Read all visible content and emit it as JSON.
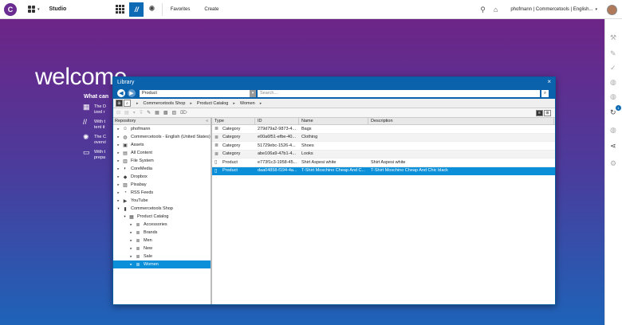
{
  "topbar": {
    "app_name": "Studio",
    "nav": [
      "Favorites",
      "Create"
    ],
    "user": "phofmann | Commercetools | English...",
    "colors": {
      "brand": "#6a2c91",
      "accent": "#0d6ab5"
    }
  },
  "welcome": {
    "title": "welcome",
    "what_can": "What can",
    "tips": [
      {
        "icon": "grid-icon",
        "lines": [
          "The D",
          "ized r"
        ]
      },
      {
        "icon": "brand-icon",
        "lines": [
          "With t",
          "tent it"
        ]
      },
      {
        "icon": "sun-icon",
        "lines": [
          "The C",
          "overvi"
        ]
      },
      {
        "icon": "folder-icon",
        "lines": [
          "With t",
          "prepa"
        ]
      }
    ]
  },
  "library": {
    "title": "Library",
    "selector_value": "Product",
    "search_placeholder": "Search...",
    "breadcrumb": [
      "Commercetools Shop",
      "Product Catalog",
      "Women"
    ],
    "tree_header": "Repository",
    "tree": [
      {
        "label": "phofmann",
        "icon": "user-icon",
        "depth": 0,
        "expander": "▸"
      },
      {
        "label": "Commercetools - English (United States)",
        "icon": "globe-icon",
        "depth": 0,
        "expander": "▸"
      },
      {
        "label": "Assets",
        "icon": "assets-icon",
        "depth": 0,
        "expander": "▸"
      },
      {
        "label": "All Content",
        "icon": "content-icon",
        "depth": 0,
        "expander": "▸"
      },
      {
        "label": "File System",
        "icon": "filesystem-icon",
        "depth": 0,
        "expander": "▸"
      },
      {
        "label": "CoreMedia",
        "icon": "coremedia-icon",
        "depth": 0,
        "expander": "▸"
      },
      {
        "label": "Dropbox",
        "icon": "dropbox-icon",
        "depth": 0,
        "expander": "▸"
      },
      {
        "label": "Pixabay",
        "icon": "pixabay-icon",
        "depth": 0,
        "expander": "▸"
      },
      {
        "label": "RSS Feeds",
        "icon": "rss-icon",
        "depth": 0,
        "expander": "▸"
      },
      {
        "label": "YouTube",
        "icon": "youtube-icon",
        "depth": 0,
        "expander": "▸"
      },
      {
        "label": "Commercetools Shop",
        "icon": "shop-icon",
        "depth": 0,
        "expander": "▾"
      },
      {
        "label": "Product Catalog",
        "icon": "catalog-icon",
        "depth": 1,
        "expander": "▾"
      },
      {
        "label": "Accessories",
        "icon": "category-icon",
        "depth": 2,
        "expander": "▸"
      },
      {
        "label": "Brands",
        "icon": "category-icon",
        "depth": 2,
        "expander": "▸"
      },
      {
        "label": "Men",
        "icon": "category-icon",
        "depth": 2,
        "expander": "▸"
      },
      {
        "label": "New",
        "icon": "category-icon",
        "depth": 2,
        "expander": "▸"
      },
      {
        "label": "Sale",
        "icon": "category-icon",
        "depth": 2,
        "expander": "▸"
      },
      {
        "label": "Women",
        "icon": "category-icon",
        "depth": 2,
        "expander": "▸",
        "selected": true
      }
    ],
    "columns": [
      "Type",
      "ID",
      "Name",
      "Description"
    ],
    "rows": [
      {
        "type": "Category",
        "id": "279d79a2-9873-4...",
        "name": "Bags",
        "desc": ""
      },
      {
        "type": "Category",
        "id": "e00a6f51-efbe-40...",
        "name": "Clothing",
        "desc": ""
      },
      {
        "type": "Category",
        "id": "51729ebc-1526-4...",
        "name": "Shoes",
        "desc": ""
      },
      {
        "type": "Category",
        "id": "abe106a9-47b1-4...",
        "name": "Looks",
        "desc": ""
      },
      {
        "type": "Product",
        "id": "e773f1c3-1958-45...",
        "name": "Shirt Aspesi white",
        "desc": "Shirt Aspesi white"
      },
      {
        "type": "Product",
        "id": "daa04858-f194-4a...",
        "name": "T-Shirt Moschino Cheap And C...",
        "desc": "T-Shirt Moschino Cheap And Chic black",
        "selected": true
      }
    ],
    "colors": {
      "titlebar": "#0a62ad",
      "selection": "#0a8fd8"
    }
  }
}
